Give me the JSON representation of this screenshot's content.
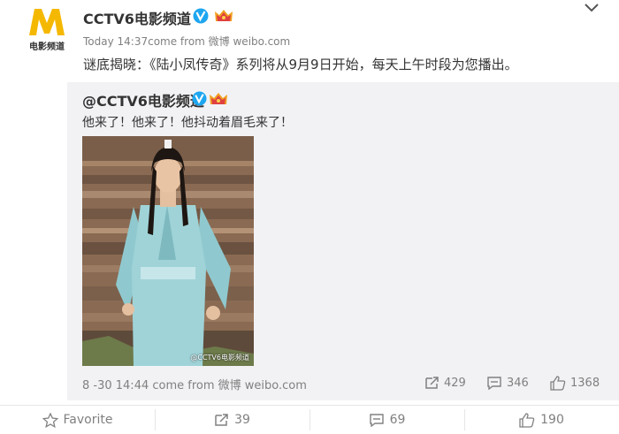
{
  "post": {
    "author": "CCTV6电影频道",
    "logo_text": "电影频道",
    "time": "Today 14:37",
    "source": "come from 微博 weibo.com",
    "text": "谜底揭晓：《陆小凤传奇》系列将从9月9日开始，每天上午时段为您播出。"
  },
  "repost": {
    "author": "@CCTV6电影频道",
    "text": "他来了！他来了！他抖动着眉毛来了！",
    "photo_watermark": "@CCTV6电影频道",
    "time": "8 -30 14:44",
    "source": "come from 微博 weibo.com",
    "forwards": "429",
    "comments": "346",
    "likes": "1368"
  },
  "bottom_bar": {
    "favorite_label": "Favorite",
    "forward_count": "39",
    "comment_count": "69",
    "like_count": "190"
  },
  "colors": {
    "logo_yellow": "#f5b800",
    "verified_blue": "#1ea6f0",
    "meta_gray": "#808080",
    "repost_bg": "#f2f2f5"
  },
  "icons": [
    "menu-chevron-icon",
    "verified-badge-icon",
    "member-crown-icon",
    "forward-icon",
    "comment-icon",
    "like-icon",
    "star-icon"
  ]
}
